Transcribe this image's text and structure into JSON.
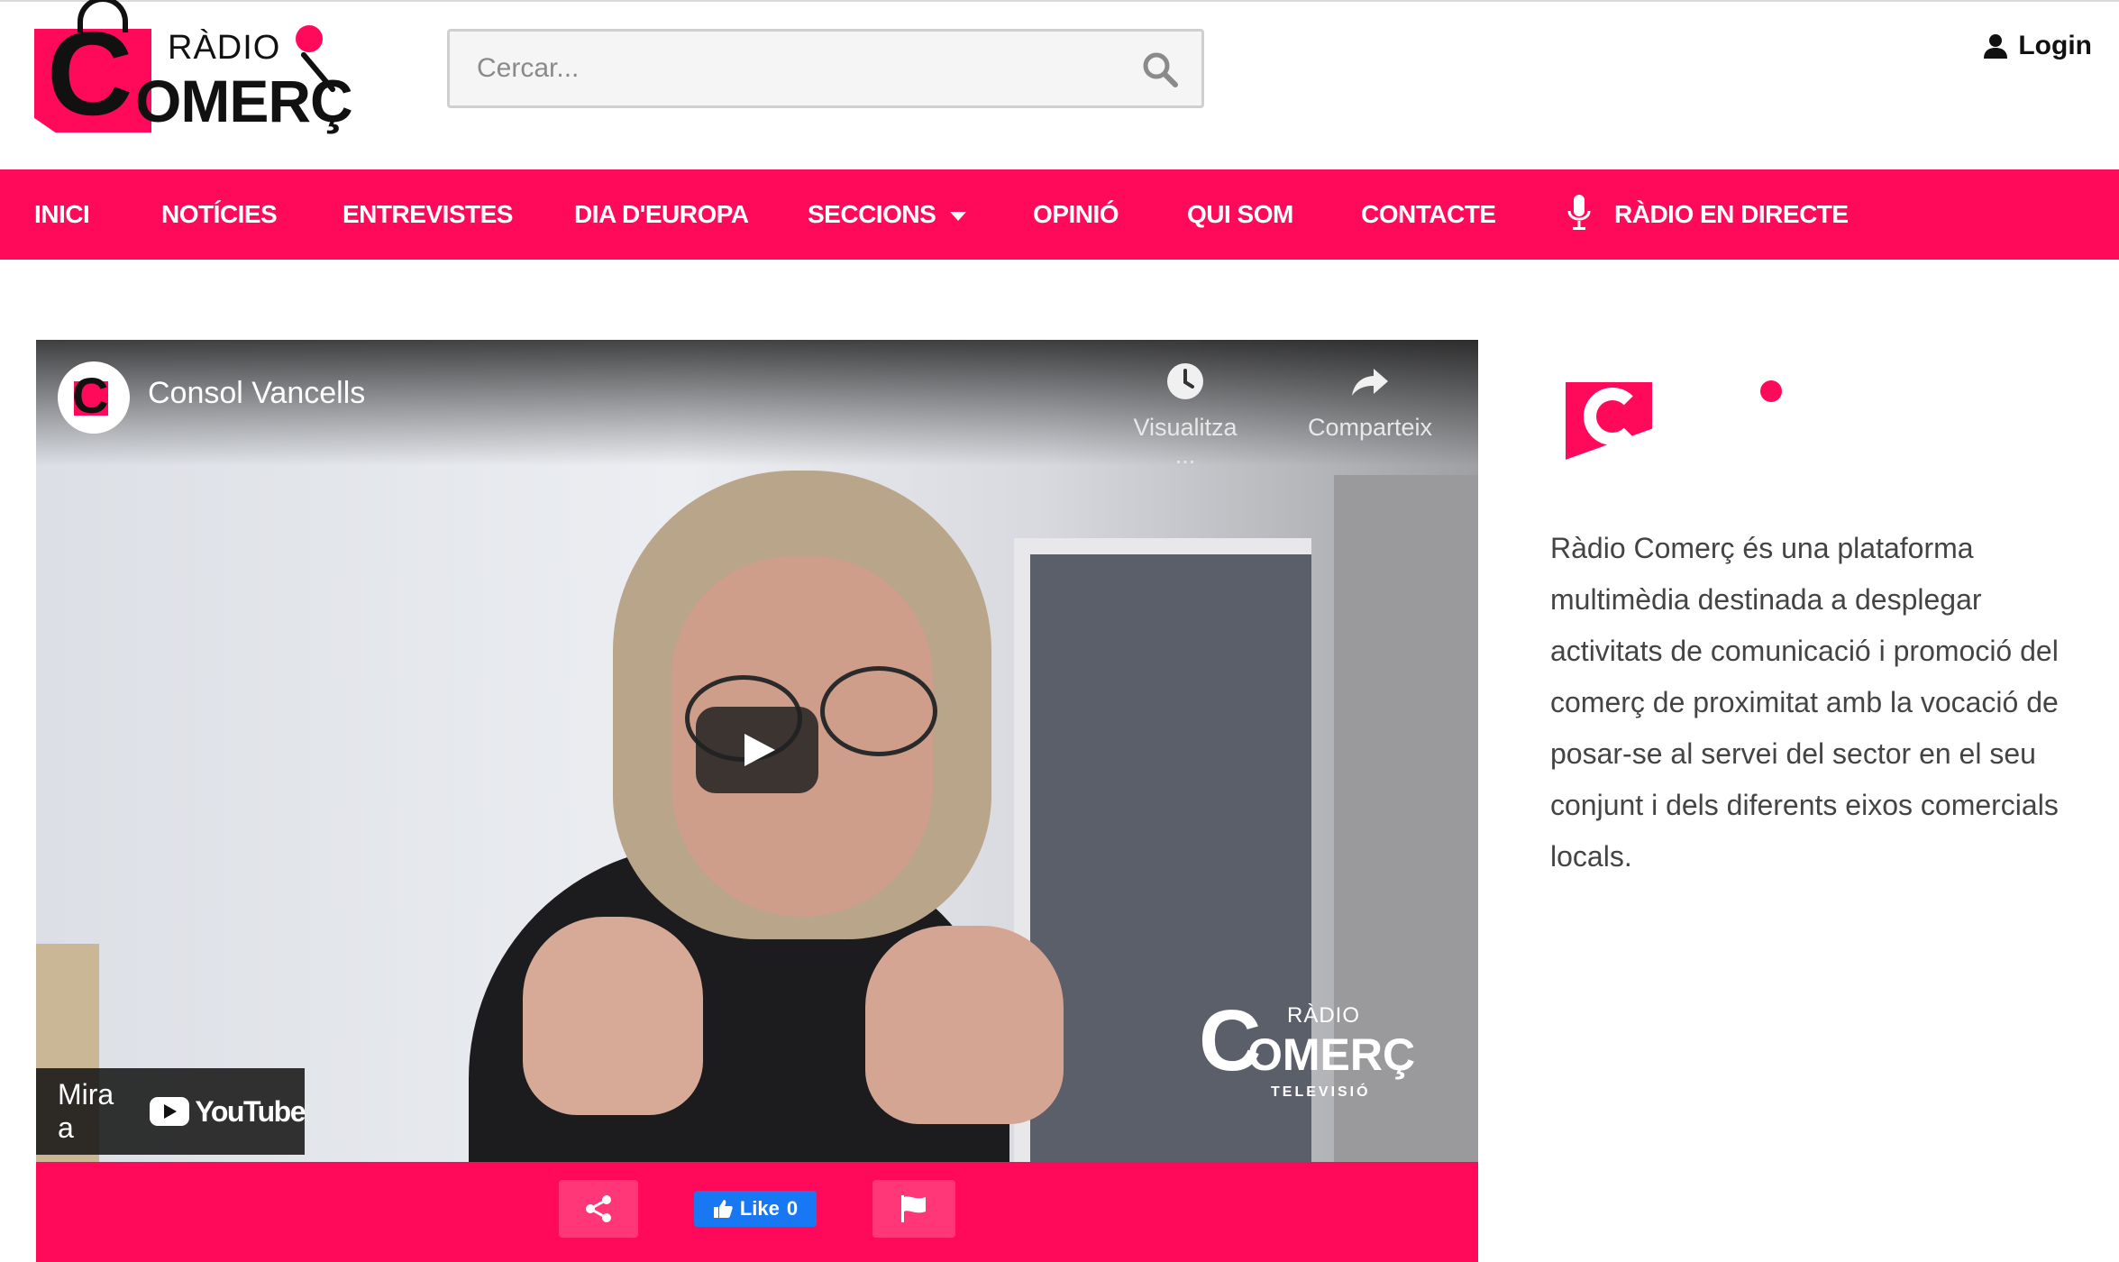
{
  "header": {
    "logo": {
      "radio_text": "RÀDIO",
      "main_text": "OMERÇ",
      "c_letter": "C"
    },
    "search": {
      "placeholder": "Cercar..."
    },
    "login_label": "Login"
  },
  "nav": {
    "items": [
      {
        "label": "INICI"
      },
      {
        "label": "NOTÍCIES"
      },
      {
        "label": "ENTREVISTES"
      },
      {
        "label": "DIA D'EUROPA"
      },
      {
        "label": "SECCIONS",
        "has_dropdown": true
      },
      {
        "label": "OPINIÓ"
      },
      {
        "label": "QUI SOM"
      },
      {
        "label": "CONTACTE"
      },
      {
        "label": "RÀDIO EN DIRECTE",
        "icon": "microphone-icon"
      }
    ],
    "background_color": "#ff0a5a"
  },
  "video": {
    "channel_title": "Consol Vancells",
    "watch_later_label": "Visualitza ...",
    "share_label": "Comparteix",
    "watch_on_label": "Mira a",
    "youtube_label": "YouTube",
    "watermark": {
      "c_letter": "C",
      "radio_text": "RÀDIO",
      "main_text": "OMERÇ",
      "sub_text": "TELEVISIÓ"
    }
  },
  "actions": {
    "like_label": "Like",
    "like_count": "0"
  },
  "sidebar": {
    "description": "Ràdio Comerç és una plataforma multimèdia destinada a desplegar activitats de comunicació i promoció del comerç de proximitat amb la vocació de posar-se al servei del sector en el seu conjunt i dels diferents eixos comercials locals."
  },
  "colors": {
    "brand_pink": "#ff0a5a",
    "facebook_blue": "#1877f2"
  }
}
